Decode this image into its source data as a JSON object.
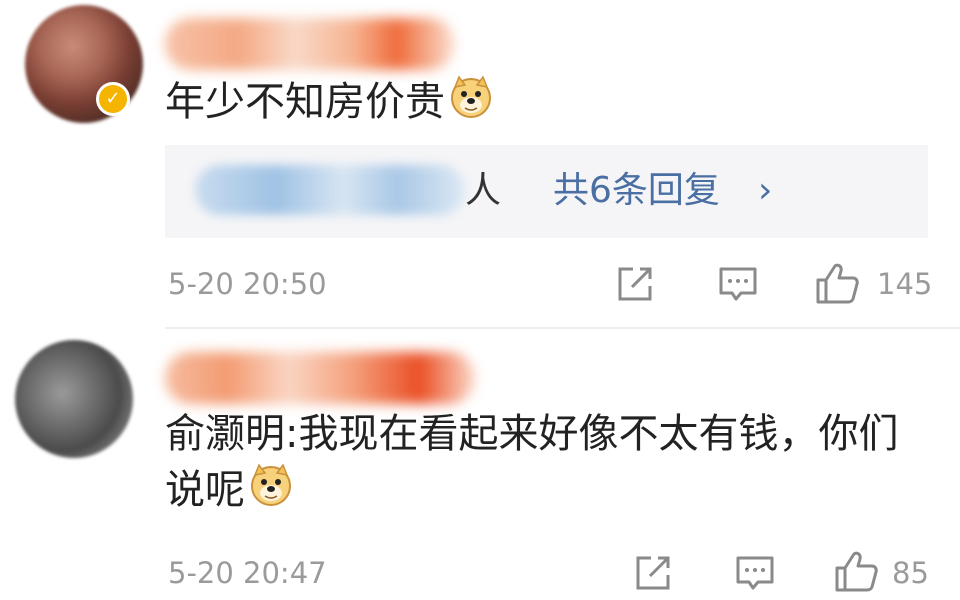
{
  "comments": [
    {
      "text": "年少不知房价贵",
      "emoji": "doge-icon",
      "verified": true,
      "reply_preview": {
        "visible_suffix": "人",
        "link": "共6条回复",
        "chevron": "›"
      },
      "time": "5-20 20:50",
      "likes": "145"
    },
    {
      "text": "俞灏明:我现在看起来好像不太有钱，你们说呢",
      "emoji": "doge-icon",
      "time": "5-20 20:47",
      "likes": "85"
    }
  ],
  "colors": {
    "verified_badge": "#f5b400",
    "link": "#4a6fa3",
    "meta_gray": "#9a9a9a"
  }
}
